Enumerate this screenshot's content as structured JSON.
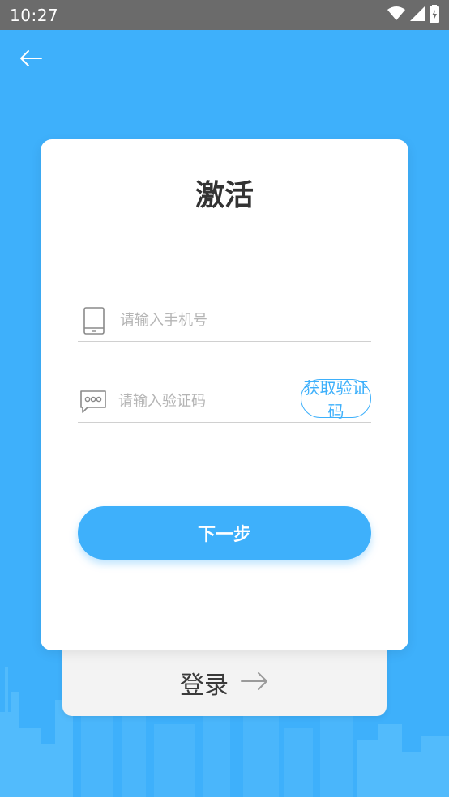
{
  "status_bar": {
    "time": "10:27",
    "icons": [
      "wifi-icon",
      "signal-icon",
      "battery-icon"
    ]
  },
  "header": {
    "back_icon": "arrow-left-icon"
  },
  "card": {
    "title": "激活",
    "phone_field": {
      "icon": "phone-icon",
      "placeholder": "请输入手机号",
      "value": ""
    },
    "code_field": {
      "icon": "message-icon",
      "placeholder": "请输入验证码",
      "value": ""
    },
    "get_code_label": "获取验证码",
    "next_label": "下一步"
  },
  "footer": {
    "login_label": "登录",
    "login_icon": "arrow-right-icon"
  },
  "colors": {
    "accent": "#3eb0fb",
    "status_bar": "#6b6b6b",
    "card": "#ffffff",
    "login_card": "#f3f3f3"
  }
}
